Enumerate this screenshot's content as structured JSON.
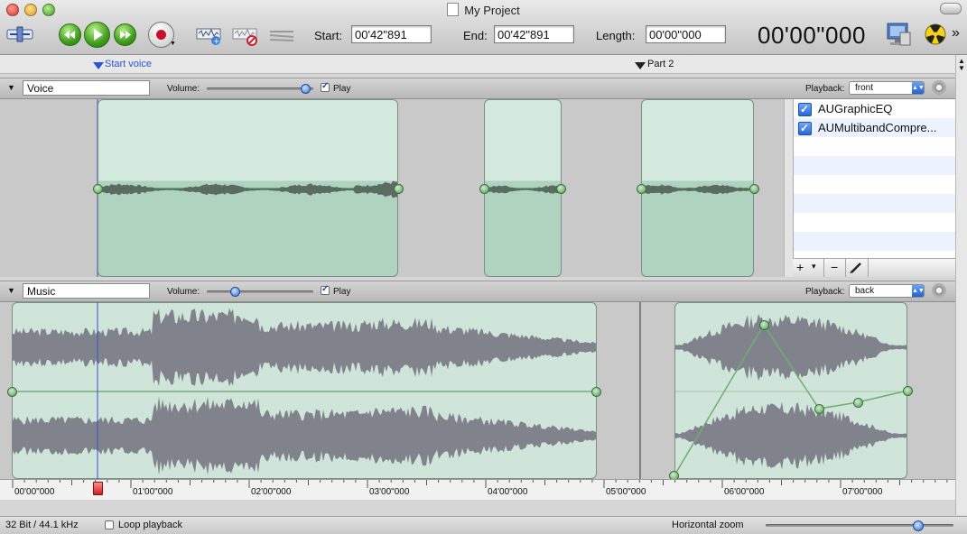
{
  "window": {
    "title": "My Project"
  },
  "transport": {
    "start_label": "Start:",
    "start_value": "00'42\"891",
    "end_label": "End:",
    "end_value": "00'42\"891",
    "length_label": "Length:",
    "length_value": "00'00\"000",
    "time_display": "00'00\"000",
    "overflow": "»"
  },
  "markers": [
    {
      "label": "Start voice",
      "color": "#2a55d6"
    },
    {
      "label": "Part 2",
      "color": "#222222"
    }
  ],
  "tracks": [
    {
      "name": "Voice",
      "volume_label": "Volume:",
      "volume_level": 0.92,
      "play_label": "Play",
      "play_checked": true,
      "playback_label": "Playback:",
      "playback_value": "front"
    },
    {
      "name": "Music",
      "volume_label": "Volume:",
      "volume_level": 0.26,
      "play_label": "Play",
      "play_checked": true,
      "playback_label": "Playback:",
      "playback_value": "back"
    }
  ],
  "effects": [
    {
      "name": "AUGraphicEQ",
      "enabled": true
    },
    {
      "name": "AUMultibandCompre...",
      "enabled": true
    }
  ],
  "effects_toolbar": {
    "add": "+",
    "menu": "▾",
    "remove": "−"
  },
  "ruler": {
    "ticks": [
      "00'00\"000",
      "01'00\"000",
      "02'00\"000",
      "03'00\"000",
      "04'00\"000",
      "05'00\"000",
      "06'00\"000",
      "07'00\"000"
    ]
  },
  "status": {
    "format": "32 Bit / 44.1 kHz",
    "loop_label": "Loop playback",
    "loop_checked": false,
    "zoom_label": "Horizontal zoom",
    "zoom_level": 0.81
  },
  "colors": {
    "clip_fill": "#cfe5d9",
    "waveform": "#7d8088",
    "playhead": "#3a4fd1",
    "accent_blue": "#2f6fd4"
  },
  "icons": [
    "marker-edit-icon",
    "rewind-icon",
    "play-icon",
    "fast-forward-icon",
    "record-icon",
    "add-track-icon",
    "remove-track-icon",
    "split-icon",
    "monitor-icon",
    "burn-icon"
  ]
}
